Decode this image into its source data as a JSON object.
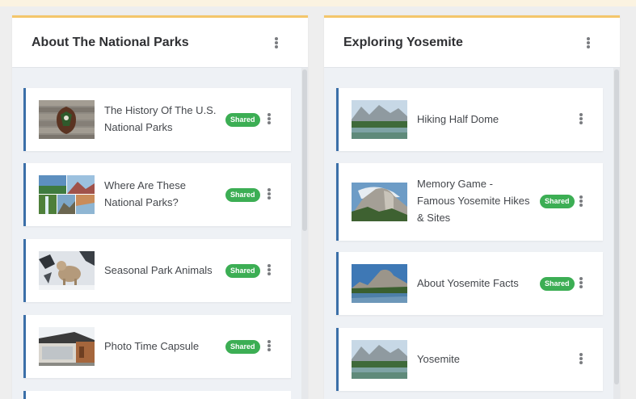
{
  "columns": [
    {
      "title": "About The National Parks",
      "cards": [
        {
          "title_lines": [
            "The History Of The U.S.",
            "National Parks"
          ],
          "badge": "Shared",
          "thumbnail": "rustic-wood-sign-with-badge"
        },
        {
          "title_lines": [
            "Where Are These",
            "National Parks?"
          ],
          "badge": "Shared",
          "thumbnail": "park-photo-collage"
        },
        {
          "title_lines": [
            "Seasonal Park Animals"
          ],
          "badge": "Shared",
          "thumbnail": "snow-animal"
        },
        {
          "title_lines": [
            "Photo Time Capsule"
          ],
          "badge": "Shared",
          "thumbnail": "modern-building"
        }
      ]
    },
    {
      "title": "Exploring Yosemite",
      "cards": [
        {
          "title_lines": [
            "Hiking Half Dome"
          ],
          "badge": "",
          "thumbnail": "yosemite-valley"
        },
        {
          "title_lines": [
            "Memory Game -",
            "Famous Yosemite Hikes",
            "& Sites"
          ],
          "badge": "Shared",
          "thumbnail": "half-dome"
        },
        {
          "title_lines": [
            "About Yosemite Facts"
          ],
          "badge": "Shared",
          "thumbnail": "yosemite-lake"
        },
        {
          "title_lines": [
            "Yosemite"
          ],
          "badge": "",
          "thumbnail": "yosemite-valley"
        }
      ]
    }
  ],
  "icons": {
    "menu": "kebab-menu-icon"
  },
  "colors": {
    "accent_top": "#f4c66b",
    "card_border": "#3b6fa8",
    "badge": "#3cae54"
  }
}
